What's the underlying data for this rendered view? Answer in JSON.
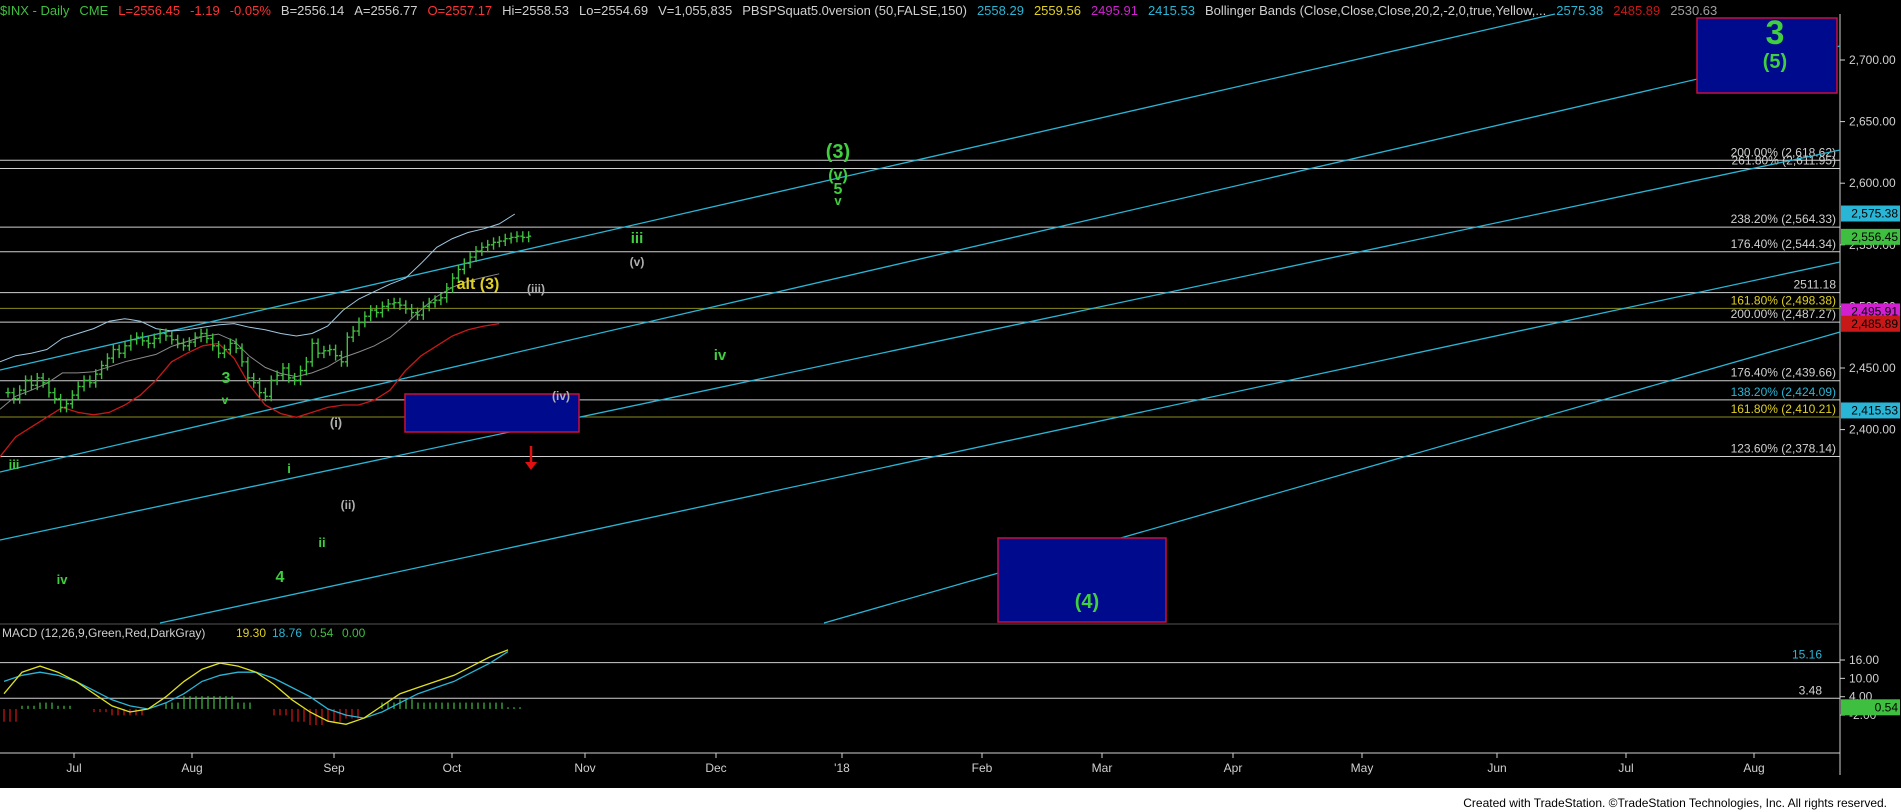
{
  "header": {
    "symbol": "$INX - Daily",
    "exchange": "CME",
    "last": "L=2556.45",
    "change": "-1.19",
    "change_pct": "-0.05%",
    "bid": "B=2556.14",
    "ask": "A=2556.77",
    "open": "O=2557.17",
    "high": "Hi=2558.53",
    "low": "Lo=2554.69",
    "volume": "V=1,055,835",
    "indicator": "PBSPSquat5.0version (50,FALSE,150)",
    "ind_v1": "2558.29",
    "ind_v2": "2559.56",
    "ind_v3": "2495.91",
    "ind_v4": "2415.53",
    "bb_label": "Bollinger Bands (Close,Close,Close,20,2,-2,0,true,Yellow,...",
    "bb_v1": "2575.38",
    "bb_v2": "2485.89",
    "bb_v3": "2530.63"
  },
  "colors": {
    "background": "#000000",
    "price_bars": "#3fbf3f",
    "channel": "#29b6d6",
    "horizontal_lines": "#d0d0d0",
    "target_box": "#000a8c",
    "target_box_border": "#c8103c",
    "wave_green": "#3fcf3f",
    "wave_yellow": "#e0d020",
    "wave_gray": "#b0b0b0",
    "bb_lower": "#c81818",
    "macd_line": "#3fbf3f",
    "macd_signal": "#e0e020",
    "arrow_red": "#e01010"
  },
  "chart_data": [
    {
      "type": "candlestick",
      "title": "$INX - Daily",
      "x_ticks": [
        "Jul",
        "Aug",
        "Sep",
        "Oct",
        "Nov",
        "Dec",
        "'18",
        "Feb",
        "Mar",
        "Apr",
        "May",
        "Jun",
        "Jul",
        "Aug"
      ],
      "ylim": [
        2363,
        2733
      ],
      "y_ticks": [
        "2,700.00",
        "2,650.00",
        "2,600.00",
        "2,550.00",
        "2,500.00",
        "2,450.00",
        "2,400.00"
      ],
      "grid": false,
      "series": [
        {
          "name": "price",
          "values": [
            2430,
            2425,
            2432,
            2440,
            2436,
            2442,
            2438,
            2430,
            2425,
            2418,
            2421,
            2428,
            2435,
            2440,
            2438,
            2445,
            2452,
            2458,
            2465,
            2462,
            2468,
            2473,
            2475,
            2472,
            2470,
            2474,
            2478,
            2476,
            2473,
            2470,
            2468,
            2471,
            2475,
            2478,
            2474,
            2468,
            2462,
            2465,
            2470,
            2466,
            2455,
            2442,
            2438,
            2430,
            2427,
            2440,
            2444,
            2450,
            2442,
            2440,
            2448,
            2455,
            2470,
            2462,
            2464,
            2465,
            2460,
            2455,
            2475,
            2480,
            2487,
            2492,
            2497,
            2495,
            2500,
            2502,
            2503,
            2501,
            2498,
            2495,
            2493,
            2500,
            2503,
            2505,
            2507,
            2515,
            2523,
            2530,
            2535,
            2540,
            2545,
            2548,
            2550,
            2552,
            2553,
            2555,
            2556,
            2557,
            2556,
            2557
          ]
        },
        {
          "name": "bb_upper",
          "values": [
            2455,
            2460,
            2462,
            2465,
            2474,
            2478,
            2482,
            2488,
            2490,
            2488,
            2482,
            2480,
            2481,
            2483,
            2485,
            2486,
            2483,
            2481,
            2478,
            2476,
            2478,
            2484,
            2497,
            2506,
            2512,
            2518,
            2523,
            2535,
            2548,
            2555,
            2560,
            2563,
            2567,
            2575
          ]
        },
        {
          "name": "bb_lower",
          "values": [
            2378,
            2394,
            2402,
            2410,
            2418,
            2414,
            2412,
            2414,
            2420,
            2428,
            2440,
            2455,
            2462,
            2468,
            2470,
            2458,
            2436,
            2420,
            2413,
            2410,
            2414,
            2418,
            2420,
            2420,
            2424,
            2432,
            2448,
            2460,
            2468,
            2476,
            2481,
            2484,
            2486
          ]
        }
      ],
      "horizontal_levels": [
        {
          "label": "200.00% (2,618.62)",
          "value": 2618.62
        },
        {
          "label": "261.80% (2,611.95)",
          "value": 2611.95
        },
        {
          "label": "238.20% (2,564.33)",
          "value": 2564.33
        },
        {
          "label": "176.40% (2,544.34)",
          "value": 2544.34
        },
        {
          "label": "2511.18",
          "value": 2511.18
        },
        {
          "label": "161.80% (2,498.38)",
          "value": 2498.38
        },
        {
          "label": "200.00% (2,487.27)",
          "value": 2487.27
        },
        {
          "label": "176.40% (2,439.66)",
          "value": 2439.66
        },
        {
          "label": "138.20% (2,424.09)",
          "value": 2424.09
        },
        {
          "label": "161.80% (2,410.21)",
          "value": 2410.21
        },
        {
          "label": "123.60% (2,378.14)",
          "value": 2378.14
        }
      ],
      "price_tags": [
        {
          "label": "2,575.38",
          "value": 2575.38,
          "color": "#29b6d6"
        },
        {
          "label": "2,556.45",
          "value": 2556.45,
          "color": "#3fbf3f"
        },
        {
          "label": "2,495.91",
          "value": 2495.91,
          "color": "#d020d0"
        },
        {
          "label": "2,485.89",
          "value": 2485.89,
          "color": "#c81818"
        },
        {
          "label": "2,415.53",
          "value": 2415.53,
          "color": "#29b6d6"
        }
      ],
      "wave_labels": [
        {
          "text": "iii"
        },
        {
          "text": "iv"
        },
        {
          "text": "3"
        },
        {
          "text": "v"
        },
        {
          "text": "i"
        },
        {
          "text": "4"
        },
        {
          "text": "ii"
        },
        {
          "text": "(i)"
        },
        {
          "text": "(ii)"
        },
        {
          "text": "alt (3)"
        },
        {
          "text": "(iii)"
        },
        {
          "text": "(iv)"
        },
        {
          "text": "iii"
        },
        {
          "text": "(v)"
        },
        {
          "text": "iv"
        },
        {
          "text": "(3)"
        },
        {
          "text": "(v)"
        },
        {
          "text": "5"
        },
        {
          "text": "v"
        },
        {
          "text": "3"
        },
        {
          "text": "(5)"
        },
        {
          "text": "(4)"
        }
      ]
    },
    {
      "type": "line",
      "title": "MACD (12,26,9,Green,Red,DarkGray)",
      "values_header": [
        "19.30",
        "18.76",
        "0.54",
        "0.00"
      ],
      "y_ticks": [
        "16.00",
        "10.00",
        "4.00",
        "-2.00"
      ],
      "horizontal_levels": [
        {
          "label": "15.16",
          "value": 15.16
        },
        {
          "label": "3.48",
          "value": 3.48
        }
      ],
      "price_tag": {
        "label": "0.54",
        "value": 0.54
      },
      "series": [
        {
          "name": "MACD",
          "values": [
            5,
            12,
            14,
            12,
            9,
            5,
            1,
            -1,
            0,
            4,
            9,
            13,
            15,
            14,
            12,
            8,
            3,
            -1,
            -4,
            -5,
            -3,
            1,
            5,
            7,
            9,
            11,
            14,
            17,
            19.3
          ]
        },
        {
          "name": "Signal",
          "values": [
            9,
            11,
            12,
            11,
            9,
            6,
            3,
            1,
            0,
            2,
            5,
            9,
            11,
            12,
            12,
            10,
            7,
            4,
            0,
            -2,
            -3,
            -1,
            2,
            5,
            7,
            9,
            12,
            15,
            18.76
          ]
        }
      ]
    }
  ],
  "footer": {
    "text": "Created with TradeStation. ©TradeStation Technologies, Inc. All rights reserved."
  }
}
